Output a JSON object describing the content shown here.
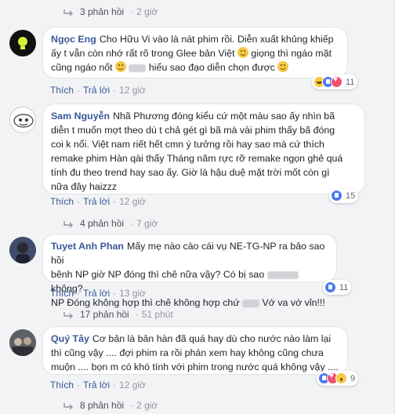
{
  "threads": [
    {
      "reply_summary": {
        "count": "3 phản hồi",
        "time": "2 giờ"
      }
    },
    {
      "name": "Ngọc Eng",
      "text_parts": [
        "Cho Hữu Vi vào là nát phim rồi. Diễn xuất khủng khiếp",
        "ấy t vẫn còn nhớ rất rõ trong Glee bản Việt",
        "giọng thì ngáo mặt",
        "cũng ngáo nốt",
        "hiểu sao đạo diễn chọn được"
      ],
      "actions": {
        "like": "Thích",
        "reply": "Trả lời",
        "time": "12 giờ"
      },
      "reaction_count": "11"
    },
    {
      "name": "Sam Nguyễn",
      "lines": [
        "Nhã Phương đóng kiểu cứ một màu sao ấy nhìn bã",
        "diễn t muốn mợt theo dù t chả gét gì bã mà vài phim thấy bã đóng",
        "coi k nổi. Việt nam riết hết cmn ý tưởng rồi hay sao mà cứ thích",
        "remake phim Hàn qài thấy Tháng năm rực rỡ remake ngọn ghẻ quá",
        "tính đu theo trend hay sao ấy. Giờ là hậu duệ mặt trời mốt còn gì",
        "nữa đây haizzz"
      ],
      "actions": {
        "like": "Thích",
        "reply": "Trả lời",
        "time": "12 giờ"
      },
      "reaction_count": "15",
      "reply_summary": {
        "count": "4 phản hồi",
        "time": "7 giờ"
      }
    },
    {
      "name": "Tuyet Anh Phan",
      "lines": [
        "Mấy mẹ nào cào cái vụ NE-TG-NP ra bảo sao hồi",
        "bênh NP giờ NP đóng thì chê nữa vậy? Có bị sao",
        "NP Đóng không hợp thì chê không hợp chứ"
      ],
      "line2_end": "không?",
      "line3_end": "Vớ va vớ vỉn!!!",
      "actions": {
        "like": "Thích",
        "reply": "Trả lời",
        "time": "13 giờ"
      },
      "reaction_count": "11",
      "reply_summary": {
        "count": "17 phản hồi",
        "time": "51 phút"
      }
    },
    {
      "name": "Quý Tây",
      "lines": [
        "Cơ bản là bản hàn đã quá hay dù cho nước nào làm lại",
        "thì cũng vậy .... đợi phim ra rồi phán xem hay không cũng chưa",
        "muộn .... bọn m có khó tính với phim trong nước quá không vậy ...."
      ],
      "actions": {
        "like": "Thích",
        "reply": "Trả lời",
        "time": "12 giờ"
      },
      "reaction_count": "9",
      "reply_summary": {
        "count": "8 phản hồi",
        "time": "2 giờ"
      }
    }
  ],
  "colors": {
    "name": "#385898",
    "meta": "#90949c",
    "bubble": "#ffffff",
    "background": "#f2f3f5"
  }
}
